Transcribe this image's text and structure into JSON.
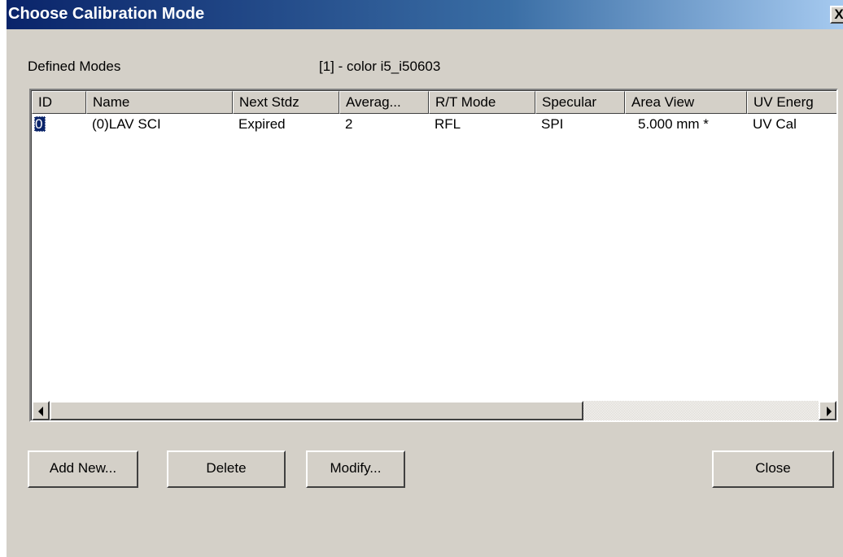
{
  "window": {
    "title": "Choose Calibration Mode",
    "close_label": "X"
  },
  "defined_modes_label": "Defined Modes",
  "instrument_label": "[1] - color i5_i50603",
  "table": {
    "columns": [
      "ID",
      "Name",
      "Next Stdz",
      "Averag...",
      "R/T Mode",
      "Specular",
      "Area View",
      "UV Energ"
    ],
    "rows": [
      [
        "0",
        "(0)LAV SCI",
        "Expired",
        "2",
        "RFL",
        "SPI",
        "5.000 mm *",
        "UV Cal"
      ]
    ],
    "selected_row": 0
  },
  "buttons": {
    "add_new": "Add New...",
    "delete": "Delete",
    "modify": "Modify...",
    "close": "Close"
  },
  "icons": {
    "scroll_left": "arrow-left-icon",
    "scroll_right": "arrow-right-icon",
    "close": "close-icon"
  }
}
